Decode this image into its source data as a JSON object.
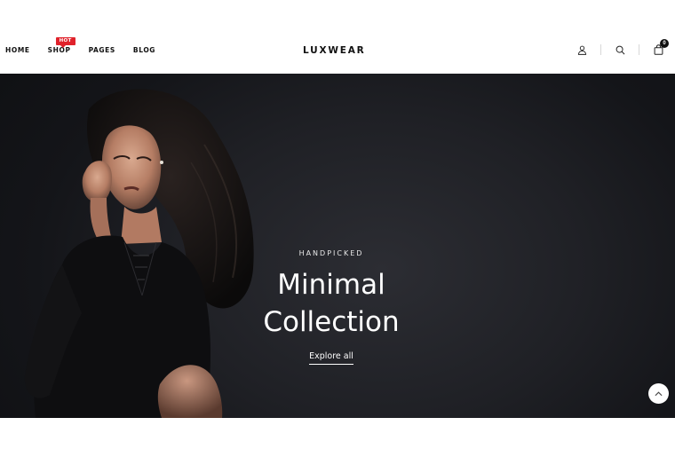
{
  "header": {
    "nav": [
      {
        "label": "HOME"
      },
      {
        "label": "SHOP",
        "badge": "HOT"
      },
      {
        "label": "PAGES"
      },
      {
        "label": "BLOG"
      }
    ],
    "logo": "LUXWEAR",
    "icons": [
      "user-icon",
      "search-icon",
      "shopping-bag-icon"
    ],
    "cart_count": "0",
    "badge_color": "#e0222b"
  },
  "hero": {
    "kicker": "HANDPICKED",
    "headline_line1": "Minimal",
    "headline_line2": "Collection",
    "cta": "Explore all",
    "background_color": "#1f2025"
  },
  "scroll_top_icon": "chevron-up-icon"
}
